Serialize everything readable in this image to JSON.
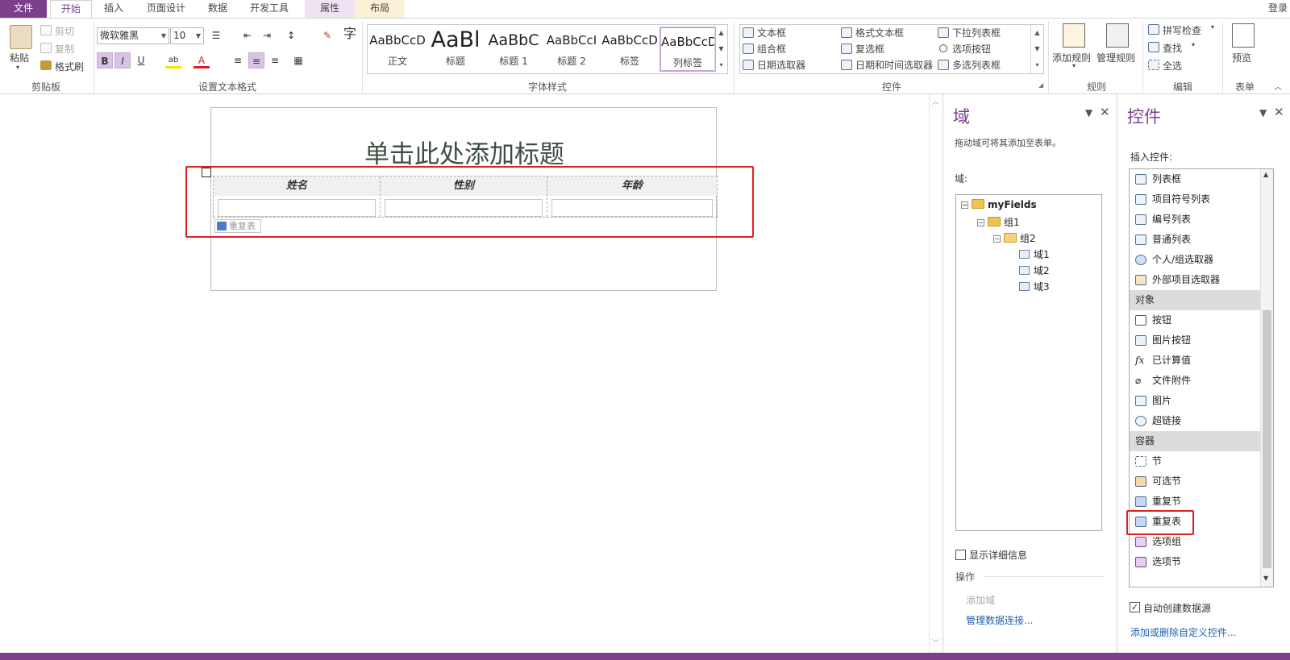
{
  "user": {
    "login": "登录"
  },
  "tabs": [
    {
      "label": "文件"
    },
    {
      "label": "开始"
    },
    {
      "label": "插入"
    },
    {
      "label": "页面设计"
    },
    {
      "label": "数据"
    },
    {
      "label": "开发工具"
    },
    {
      "label": "属性"
    },
    {
      "label": "布局"
    }
  ],
  "clipboard": {
    "paste": "粘贴",
    "cut": "剪切",
    "copy": "复制",
    "painter": "格式刷",
    "group": "剪贴板"
  },
  "font": {
    "family": "微软雅黑",
    "size": "10",
    "bold": "B",
    "italic": "I",
    "underline": "U",
    "group": "设置文本格式",
    "char": "字"
  },
  "styles": {
    "group": "字体样式",
    "items": [
      {
        "sample": "AaBbCcD",
        "name": "正文"
      },
      {
        "sample": "AaBl",
        "name": "标题"
      },
      {
        "sample": "AaBbC",
        "name": "标题 1"
      },
      {
        "sample": "AaBbCcI",
        "name": "标题 2"
      },
      {
        "sample": "AaBbCcD",
        "name": "标签"
      },
      {
        "sample": "AaBbCcD",
        "name": "列标签"
      }
    ]
  },
  "controls_gallery": {
    "group": "控件",
    "items": [
      "文本框",
      "格式文本框",
      "下拉列表框",
      "组合框",
      "复选框",
      "选项按钮",
      "日期选取器",
      "日期和时间选取器",
      "多选列表框"
    ]
  },
  "rules": {
    "add": "添加规则",
    "manage": "管理规则",
    "group": "规则"
  },
  "editing": {
    "spell": "拼写检查",
    "find": "查找",
    "selectall": "全选",
    "group": "编辑"
  },
  "form_group": {
    "preview": "预览",
    "group": "表单"
  },
  "canvas": {
    "title": "单击此处添加标题",
    "columns": [
      "姓名",
      "性别",
      "年龄"
    ],
    "repeat_tag": "重复表"
  },
  "fields_panel": {
    "title": "域",
    "hint": "拖动域可将其添加至表单。",
    "label": "域:",
    "tree": {
      "root": "myFields",
      "group1": "组1",
      "group2": "组2",
      "fields": [
        "域1",
        "域2",
        "域3"
      ]
    },
    "show_details": "显示详细信息",
    "actions_label": "操作",
    "add_field": "添加域",
    "manage_connections": "管理数据连接..."
  },
  "controls_panel": {
    "title": "控件",
    "insert_label": "插入控件:",
    "items_top": [
      "列表框",
      "项目符号列表",
      "编号列表",
      "普通列表",
      "个人/组选取器",
      "外部项目选取器"
    ],
    "cat_objects": "对象",
    "items_objects": [
      "按钮",
      "图片按钮",
      "已计算值",
      "文件附件",
      "图片",
      "超链接"
    ],
    "cat_containers": "容器",
    "items_containers": [
      "节",
      "可选节",
      "重复节",
      "重复表",
      "选项组",
      "选项节"
    ],
    "auto_create": "自动创建数据源",
    "add_remove_custom": "添加或删除自定义控件..."
  },
  "colors": {
    "accent": "#7b3f8c",
    "highlight": "#e02020"
  }
}
